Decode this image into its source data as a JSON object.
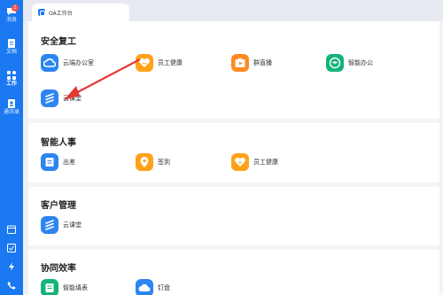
{
  "rail": {
    "items": [
      {
        "label": "消息",
        "icon": "chat-bubble-icon",
        "badge": "2"
      },
      {
        "label": "文档",
        "icon": "document-icon"
      },
      {
        "label": "工作",
        "icon": "grid-icon",
        "active": true
      },
      {
        "label": "通讯录",
        "icon": "contacts-icon"
      }
    ],
    "bottom_icons": [
      "calendar-icon",
      "checkbox-icon",
      "lightning-icon",
      "phone-icon"
    ]
  },
  "tab": {
    "label": "OA工作台"
  },
  "sections": [
    {
      "title": "安全复工",
      "apps": [
        {
          "label": "云端办公室",
          "icon": "cloud-icon"
        },
        {
          "label": "员工健康",
          "icon": "heart-smile-icon"
        },
        {
          "label": "群直播",
          "icon": "tv-play-icon"
        },
        {
          "label": "智能办公",
          "icon": "hat-icon"
        },
        {
          "label": "云课堂",
          "icon": "stripes-icon"
        }
      ]
    },
    {
      "title": "智能人事",
      "apps": [
        {
          "label": "出差",
          "icon": "suitcase-icon"
        },
        {
          "label": "签到",
          "icon": "location-pin-icon"
        },
        {
          "label": "员工健康",
          "icon": "heart-smile-icon"
        }
      ]
    },
    {
      "title": "客户管理",
      "apps": [
        {
          "label": "云课堂",
          "icon": "stripes-icon"
        }
      ]
    },
    {
      "title": "协同效率",
      "apps": [
        {
          "label": "智能填表",
          "icon": "form-icon"
        },
        {
          "label": "钉盘",
          "icon": "cloud-drive-icon"
        }
      ]
    }
  ],
  "colors": {
    "rail": "#1a78f0",
    "annotation_arrow": "#e53935",
    "blue_icon": "#2d85f0",
    "orange_icon": "#ffa21a",
    "green_icon": "#14b478"
  }
}
